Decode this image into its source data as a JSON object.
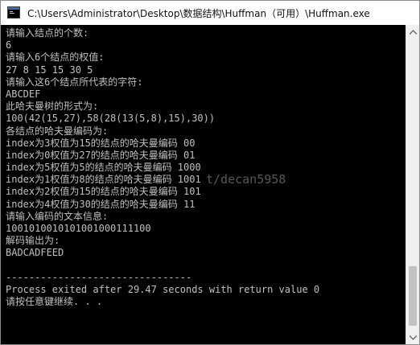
{
  "window": {
    "title": "C:\\Users\\Administrator\\Desktop\\数据结构\\Huffman（可用）\\Huffman.exe",
    "icon": "console-app-icon"
  },
  "console": {
    "lines": [
      "请输入结点的个数:",
      "6",
      "请输入6个结点的权值:",
      "27 8 15 15 30 5",
      "请输入这6个结点所代表的字符:",
      "ABCDEF",
      "此哈夫曼树的形式为:",
      "100(42(15,27),58(28(13(5,8),15),30))",
      "各结点的哈夫曼编码为:",
      "index为3权值为15的结点的哈夫曼编码 00",
      "index为0权值为27的结点的哈夫曼编码 01",
      "index为5权值为5的结点的哈夫曼编码 1000",
      "index为1权值为8的结点的哈夫曼编码 1001",
      "index为2权值为15的结点的哈夫曼编码 101",
      "index为4权值为30的结点的哈夫曼编码 11",
      "请输入编码的文本信息:",
      "1001010010101001000111100",
      "解码输出为:",
      "BADCADFEED",
      "",
      "--------------------------------",
      "Process exited after 29.47 seconds with return value 0",
      "请按任意键继续. . ."
    ],
    "watermark": "t/decan5958",
    "colors": {
      "background": "#000000",
      "text": "#c0c0c0"
    }
  },
  "scrollbar": {
    "up_icon": "scroll-up-arrow",
    "down_icon": "scroll-down-arrow"
  }
}
